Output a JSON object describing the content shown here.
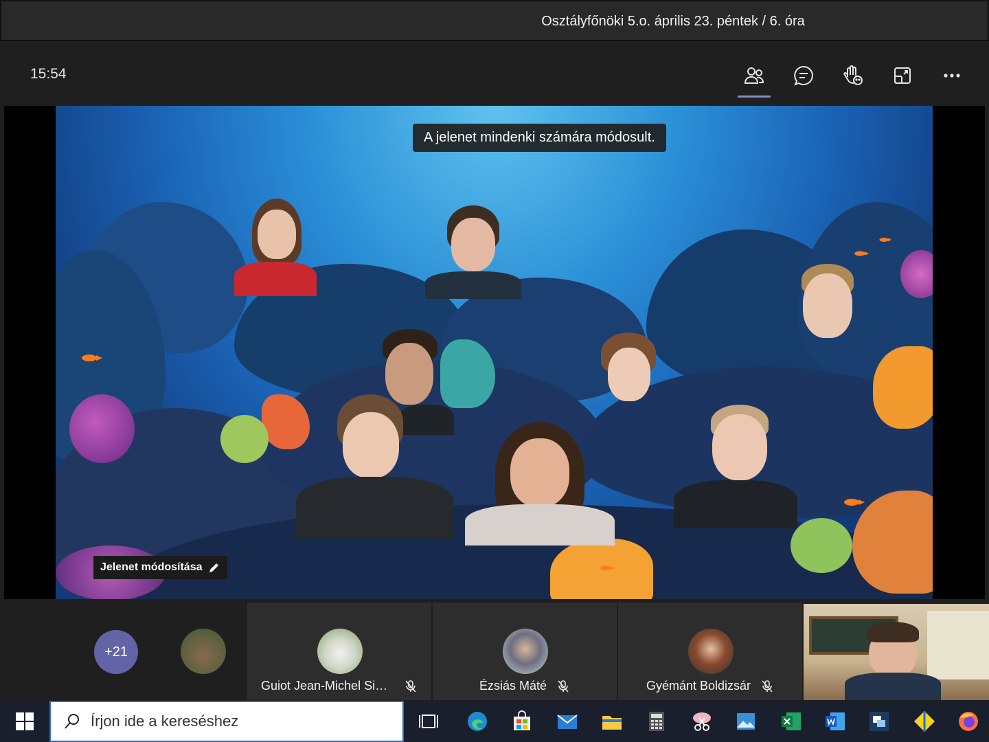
{
  "window": {
    "title": "Osztályfőnöki 5.o. április 23. péntek / 6. óra"
  },
  "toolbar": {
    "clock": "15:54",
    "buttons": [
      "participants-icon",
      "chat-icon",
      "raise-hand-icon",
      "room-icon",
      "more-icon"
    ]
  },
  "stage": {
    "toast": "A jelenet mindenki számára módosult.",
    "edit_scene_label": "Jelenet módosítása"
  },
  "strip": {
    "more_count": "+21",
    "participants": [
      {
        "name": "Guiot Jean-Michel Sim...",
        "muted": true
      },
      {
        "name": "Ézsiás Máté",
        "muted": true
      },
      {
        "name": "Gyémánt Boldizsár",
        "muted": true
      }
    ]
  },
  "taskbar": {
    "search_placeholder": "Írjon ide a kereséshez",
    "apps": [
      "task-view-icon",
      "edge-icon",
      "store-icon",
      "mail-icon",
      "file-explorer-icon",
      "calculator-icon",
      "snip-icon",
      "photos-icon",
      "excel-icon",
      "word-icon",
      "remote-desktop-icon",
      "app-icon",
      "firefox-icon"
    ]
  },
  "colors": {
    "accent": "#6264a7",
    "taskbar": "#1a1f2e",
    "background": "#1f1f1f"
  }
}
